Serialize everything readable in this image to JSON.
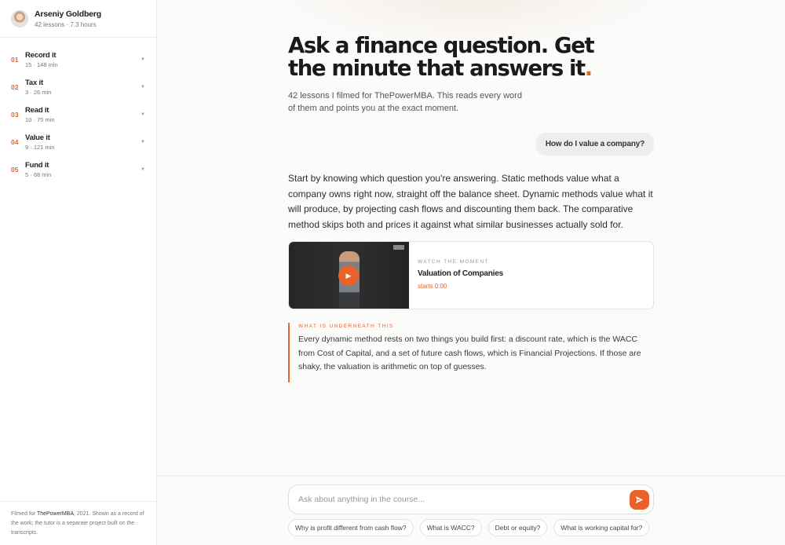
{
  "profile": {
    "name": "Arseniy Goldberg",
    "meta": "42 lessons · 7.3 hours"
  },
  "modules": [
    {
      "num": "01",
      "title": "Record it",
      "meta": "15 · 148 min"
    },
    {
      "num": "02",
      "title": "Tax it",
      "meta": "3 · 26 min"
    },
    {
      "num": "03",
      "title": "Read it",
      "meta": "10 · 75 min"
    },
    {
      "num": "04",
      "title": "Value it",
      "meta": "9 · 121 min"
    },
    {
      "num": "05",
      "title": "Fund it",
      "meta": "5 · 68 min"
    }
  ],
  "footer": {
    "prefix": "Filmed for ",
    "brand": "ThePowerMBA",
    "suffix": ", 2021. Shown as a record of the work; the tutor is a separate project built on the transcripts."
  },
  "hero": {
    "line1": "Ask a finance question. Get",
    "line2": "the minute that answers it",
    "dot": ".",
    "subhead": "42 lessons I filmed for ThePowerMBA. This reads every word of them and points you at the exact moment."
  },
  "conversation": {
    "question": "How do I value a company?",
    "answer": "Start by knowing which question you're answering. Static methods value what a company owns right now, straight off the balance sheet. Dynamic methods value what it will produce, by projecting cash flows and discounting them back. The comparative method skips both and prices it against what similar businesses actually sold for.",
    "video": {
      "kicker": "WATCH THE MOMENT",
      "title": "Valuation of Companies",
      "start": "starts 0:00",
      "play_icon": "play-icon"
    },
    "underneath": {
      "kicker": "WHAT IS UNDERNEATH THIS",
      "text": "Every dynamic method rests on two things you build first: a discount rate, which is the WACC from Cost of Capital, and a set of future cash flows, which is Financial Projections. If those are shaky, the valuation is arithmetic on top of guesses."
    }
  },
  "composer": {
    "placeholder": "Ask about anything in the course...",
    "send_icon": "send-icon"
  },
  "suggestions": [
    "Why is profit different from cash flow?",
    "What is WACC?",
    "Debt or equity?",
    "What is working capital for?"
  ],
  "colors": {
    "accent": "#e8622a",
    "text": "#1a1a1a",
    "muted": "#777777",
    "background": "#fbfbfa"
  }
}
